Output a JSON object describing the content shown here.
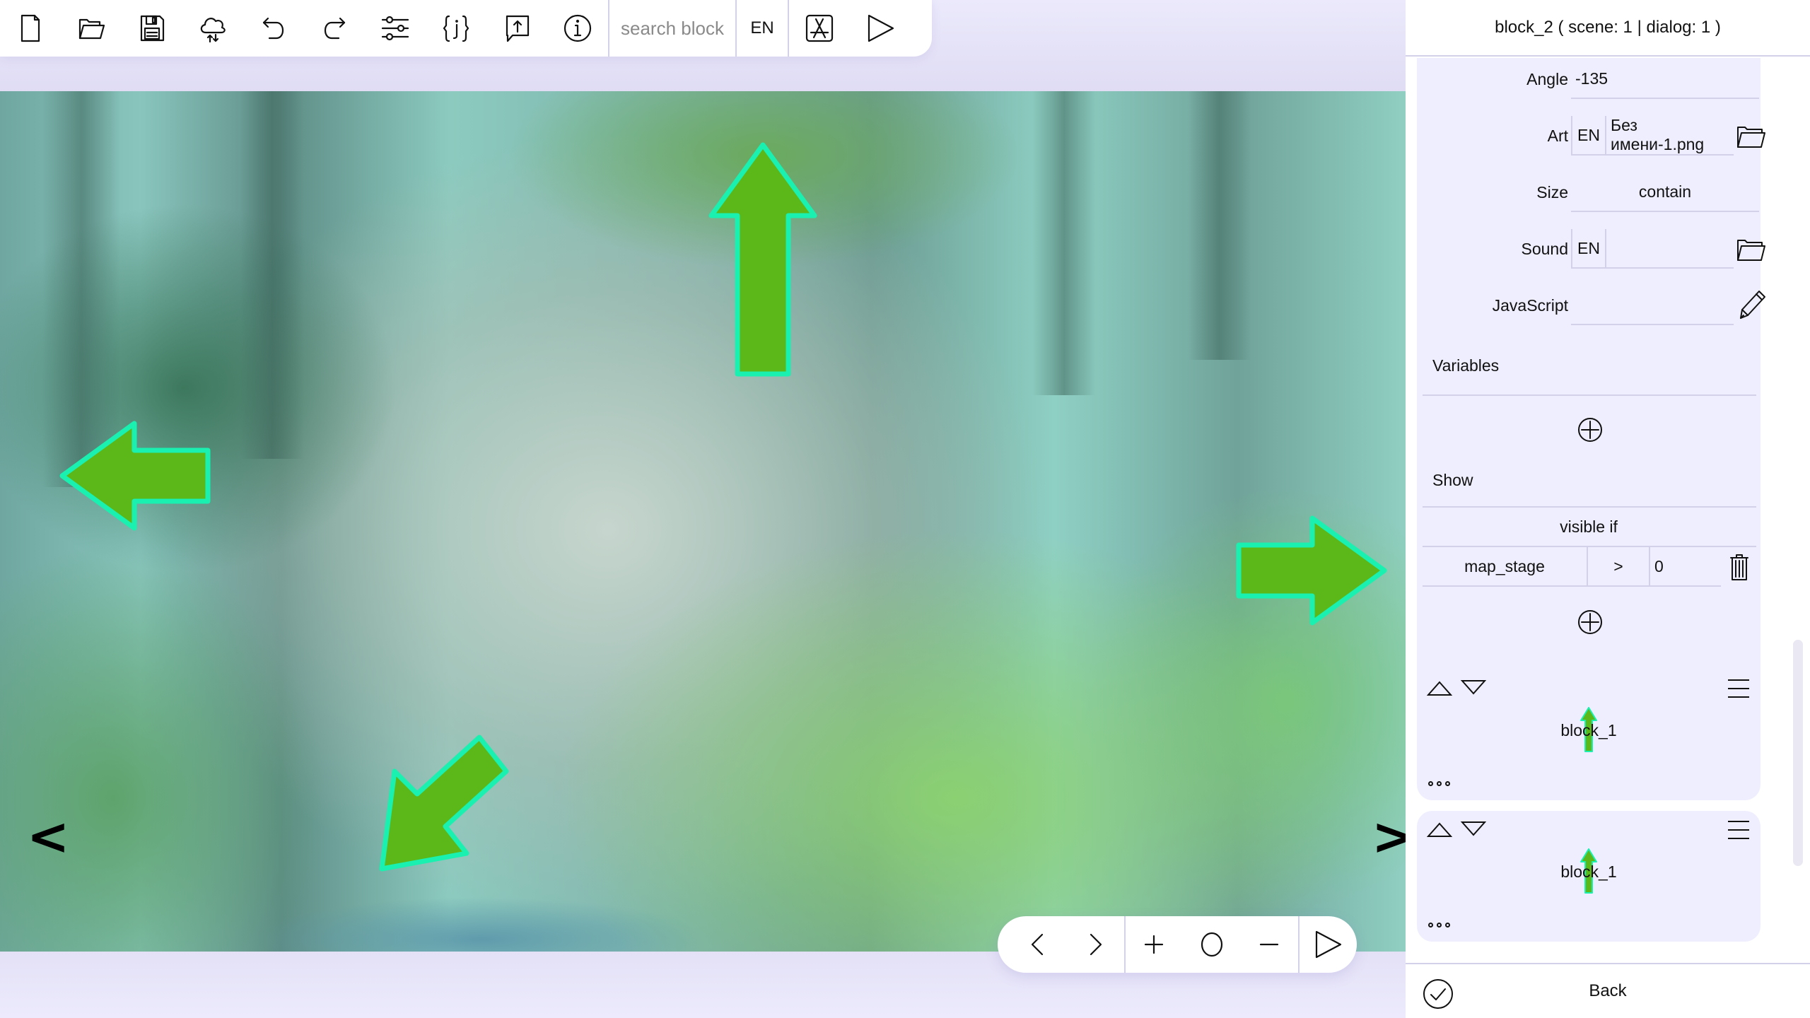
{
  "toolbar": {
    "buttons": [
      {
        "name": "new-file",
        "icon": "file-icon"
      },
      {
        "name": "open",
        "icon": "folder-open-icon"
      },
      {
        "name": "save",
        "icon": "floppy-disk-icon"
      },
      {
        "name": "cloud-sync",
        "icon": "cloud-sync-icon"
      },
      {
        "name": "undo",
        "icon": "undo-icon"
      },
      {
        "name": "redo",
        "icon": "redo-icon"
      },
      {
        "name": "settings",
        "icon": "sliders-icon"
      },
      {
        "name": "json",
        "icon": "json-braces-icon"
      },
      {
        "name": "export",
        "icon": "upload-bubble-icon"
      },
      {
        "name": "info",
        "icon": "info-icon"
      }
    ],
    "search_placeholder": "search block",
    "search_value": "",
    "language": "EN",
    "extra_buttons": [
      {
        "name": "app-store",
        "icon": "app-store-icon"
      },
      {
        "name": "play",
        "icon": "play-icon"
      }
    ]
  },
  "canvas": {
    "background_description": "forest scene with mossy rock",
    "arrows": [
      {
        "direction": "up",
        "angle": 0
      },
      {
        "direction": "left",
        "angle": -90
      },
      {
        "direction": "right",
        "angle": 90
      },
      {
        "direction": "down-left",
        "angle": -135
      }
    ],
    "prev_label": "<",
    "next_label": ">",
    "arrow_fill": "#5cb818",
    "arrow_outline": "#1af0b0"
  },
  "zoom_controls": {
    "buttons": [
      "previous",
      "next",
      "zoom-in",
      "reset-zoom",
      "zoom-out",
      "play"
    ]
  },
  "panel": {
    "title": "block_2 ( scene: 1 | dialog: 1 )",
    "properties": {
      "angle": {
        "label": "Angle",
        "value": "-135"
      },
      "art": {
        "label": "Art",
        "lang": "EN",
        "value": "Без имени-1.png"
      },
      "size": {
        "label": "Size",
        "value": "contain"
      },
      "sound": {
        "label": "Sound",
        "lang": "EN",
        "value": ""
      },
      "javascript": {
        "label": "JavaScript",
        "value": ""
      }
    },
    "variables_label": "Variables",
    "show_label": "Show",
    "visible_if_label": "visible if",
    "conditions": [
      {
        "variable": "map_stage",
        "operator": ">",
        "value": "0"
      }
    ],
    "linked_blocks": [
      {
        "name": "block_1"
      },
      {
        "name": "block_1"
      }
    ],
    "footer": {
      "back_label": "Back"
    }
  }
}
